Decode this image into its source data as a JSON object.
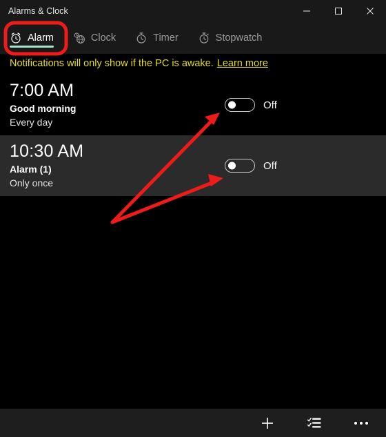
{
  "window": {
    "title": "Alarms & Clock",
    "controls": [
      {
        "name": "minimize",
        "label": "Minimize"
      },
      {
        "name": "maximize",
        "label": "Maximize"
      },
      {
        "name": "close",
        "label": "Close"
      }
    ]
  },
  "tabs": [
    {
      "label": "Alarm",
      "icon": "alarm-clock-icon",
      "active": true
    },
    {
      "label": "Clock",
      "icon": "world-clock-icon",
      "active": false
    },
    {
      "label": "Timer",
      "icon": "timer-icon",
      "active": false
    },
    {
      "label": "Stopwatch",
      "icon": "stopwatch-icon",
      "active": false
    }
  ],
  "notice": {
    "text": "Notifications will only show if the PC is awake.",
    "link": "Learn more"
  },
  "alarms": [
    {
      "time": "7:00 AM",
      "name": "Good morning",
      "repeat": "Every day",
      "toggle_state": "Off",
      "highlighted": false
    },
    {
      "time": "10:30 AM",
      "name": "Alarm (1)",
      "repeat": "Only once",
      "toggle_state": "Off",
      "highlighted": true
    }
  ],
  "commandbar": [
    {
      "label": "Add new alarm",
      "icon": "plus-icon"
    },
    {
      "label": "Select alarms",
      "icon": "select-list-icon"
    },
    {
      "label": "See more",
      "icon": "ellipsis-icon"
    }
  ],
  "colors": {
    "accent_underline": "#a5e6cf",
    "notice_text": "#e3dd1d",
    "annotation_red": "#ee1b1b",
    "titlebar_bg": "#191919",
    "row_highlight_bg": "#2b2b2b",
    "window_bg": "#000000",
    "commandbar_bg": "#1e1e1e"
  },
  "annotations": {
    "highlight_box": {
      "label": "Alarm tab highlight box"
    },
    "arrow_top": {
      "label": "Arrow pointing to first alarm toggle"
    },
    "arrow_bottom": {
      "label": "Arrow pointing to second alarm toggle"
    }
  }
}
